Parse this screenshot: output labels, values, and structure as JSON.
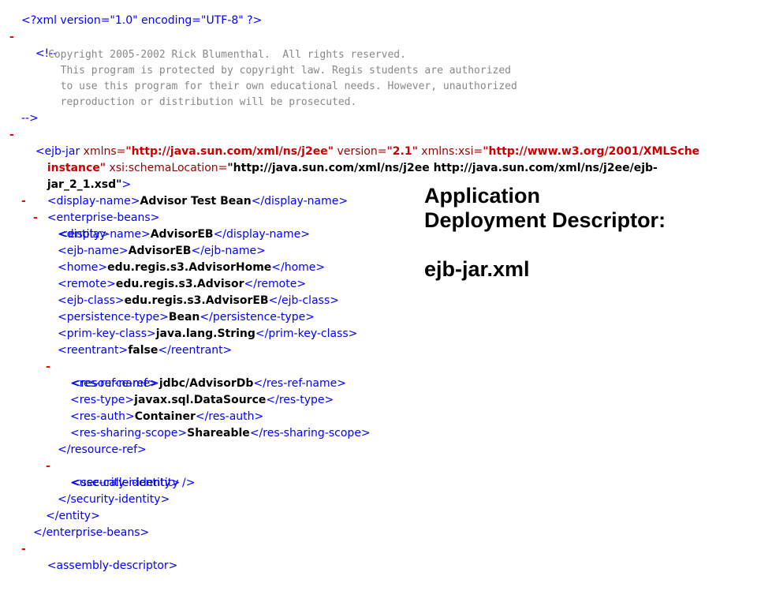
{
  "toggle": "-",
  "xml_decl": "<?xml version=\"1.0\" encoding=\"UTF-8\" ?>",
  "comment": {
    "open": "<!--",
    "lines": [
      "Copyright 2005-2002 Rick Blumenthal.  All rights reserved.",
      "  This program is protected by copyright law. Regis students are authorized",
      "  to use this program for their own educational needs. However, unauthorized",
      "  reproduction or distribution will be prosecuted."
    ],
    "close": "-->"
  },
  "ejb_jar": {
    "tag_open": "<ejb-jar",
    "attr1_name": " xmlns=",
    "attr1_value": "\"http://java.sun.com/xml/ns/j2ee\"",
    "attr2_name": " version=",
    "attr2_value": "\"2.1\"",
    "attr3_name": " xmlns:xsi=",
    "attr3_value_part1": "\"http://www.w3.org/2001/XMLSche",
    "attr3_value_part2": "instance\"",
    "attr4_name": " xsi:schemaLocation=",
    "attr4_value_part1": "\"http://java.sun.com/xml/ns/j2ee http://java.sun.com/xml/ns/j2ee/ejb-",
    "attr4_value_part2": "jar_2_1.xsd\"",
    "tag_close": ">"
  },
  "display_name": {
    "open": "<display-name>",
    "value": "Advisor Test Bean",
    "close": "</display-name>"
  },
  "enterprise_beans": {
    "open": "<enterprise-beans>",
    "close": "</enterprise-beans>"
  },
  "entity": {
    "open": "<entity>",
    "close": "</entity>",
    "fields": [
      {
        "open": "<display-name>",
        "value": "AdvisorEB",
        "close": "</display-name>"
      },
      {
        "open": "<ejb-name>",
        "value": "AdvisorEB",
        "close": "</ejb-name>"
      },
      {
        "open": "<home>",
        "value": "edu.regis.s3.AdvisorHome",
        "close": "</home>"
      },
      {
        "open": "<remote>",
        "value": "edu.regis.s3.Advisor",
        "close": "</remote>"
      },
      {
        "open": "<ejb-class>",
        "value": "edu.regis.s3.AdvisorEB",
        "close": "</ejb-class>"
      },
      {
        "open": "<persistence-type>",
        "value": "Bean",
        "close": "</persistence-type>"
      },
      {
        "open": "<prim-key-class>",
        "value": "java.lang.String",
        "close": "</prim-key-class>"
      },
      {
        "open": "<reentrant>",
        "value": "false",
        "close": "</reentrant>"
      }
    ]
  },
  "resource_ref": {
    "open": "<resource-ref>",
    "close": "</resource-ref>",
    "fields": [
      {
        "open": "<res-ref-name>",
        "value": "jdbc/AdvisorDb",
        "close": "</res-ref-name>"
      },
      {
        "open": "<res-type>",
        "value": "javax.sql.DataSource",
        "close": "</res-type>"
      },
      {
        "open": "<res-auth>",
        "value": "Container",
        "close": "</res-auth>"
      },
      {
        "open": "<res-sharing-scope>",
        "value": "Shareable",
        "close": "</res-sharing-scope>"
      }
    ]
  },
  "security_identity": {
    "open": "<security-identity>",
    "child": "<use-caller-identity />",
    "close": "</security-identity>"
  },
  "assembly_descriptor": {
    "open": "<assembly-descriptor>"
  },
  "caption": {
    "line1": "Application",
    "line2": "Deployment Descriptor:",
    "line3": "",
    "line4": "ejb-jar.xml"
  }
}
